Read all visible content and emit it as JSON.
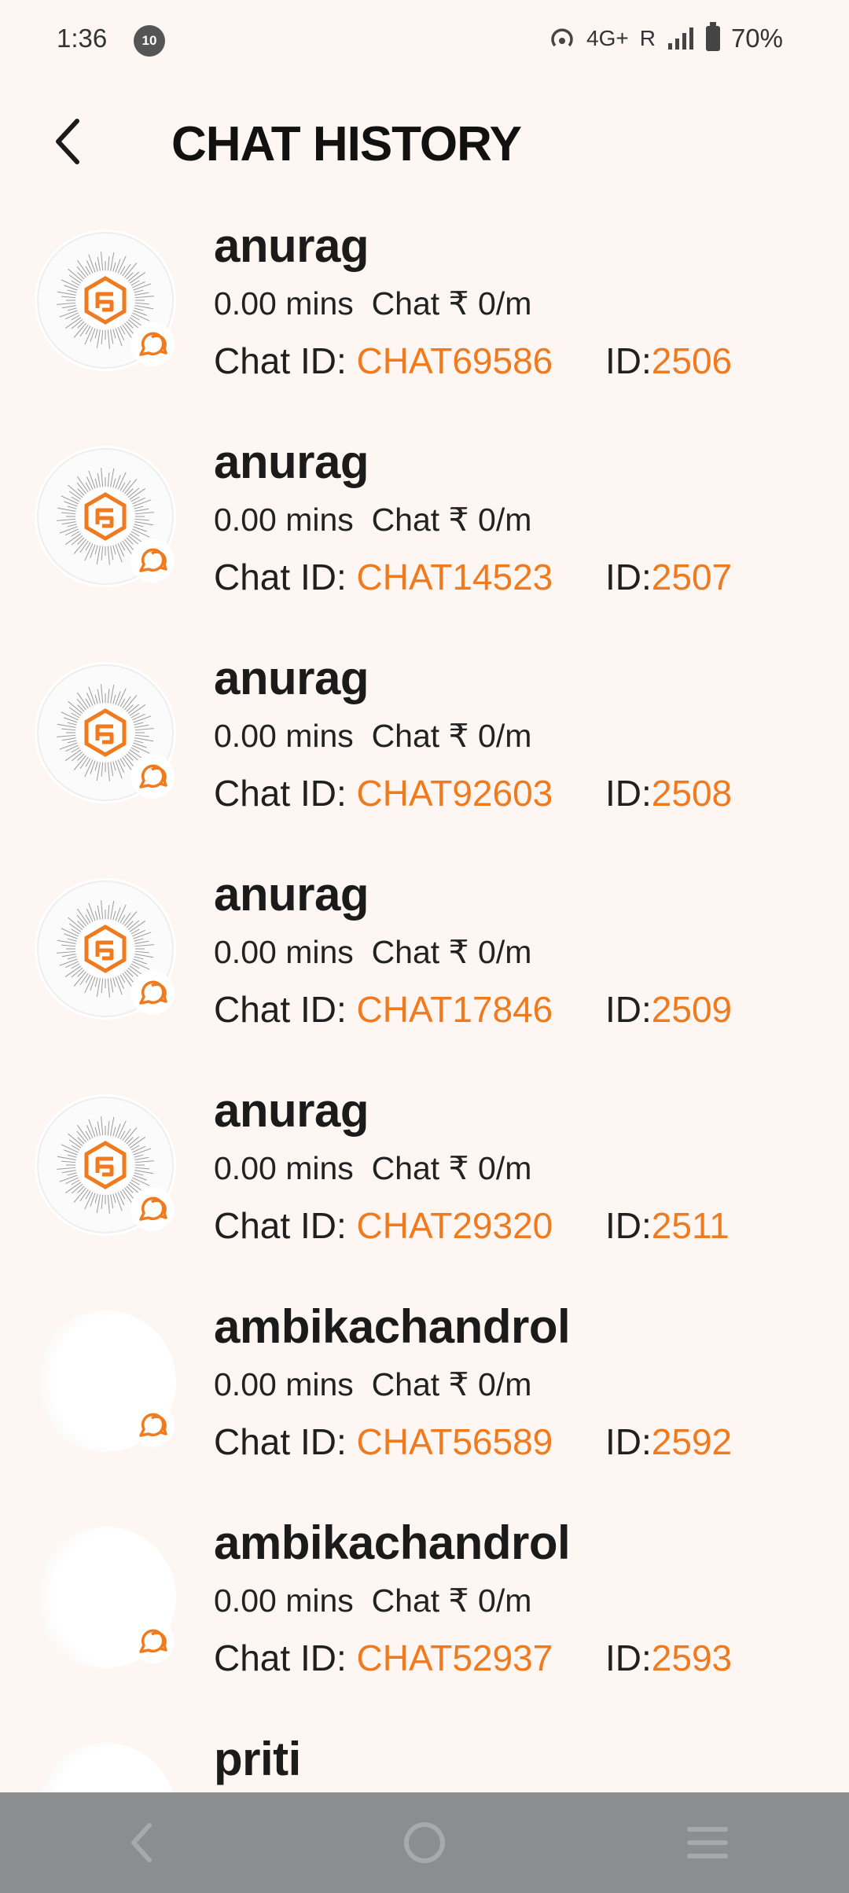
{
  "status_bar": {
    "time": "1:36",
    "notification_count": "10",
    "network": "4G+",
    "roaming": "R",
    "battery": "70%"
  },
  "header": {
    "title": "CHAT HISTORY"
  },
  "chats": [
    {
      "name": "anurag",
      "duration": "0.00 mins",
      "rate": "Chat ₹ 0/m",
      "chat_id_label": "Chat ID: ",
      "chat_id": "CHAT69586",
      "id_label": "ID:",
      "id": "2506",
      "avatar": "logo"
    },
    {
      "name": "anurag",
      "duration": "0.00 mins",
      "rate": "Chat ₹ 0/m",
      "chat_id_label": "Chat ID: ",
      "chat_id": "CHAT14523",
      "id_label": "ID:",
      "id": "2507",
      "avatar": "logo"
    },
    {
      "name": "anurag",
      "duration": "0.00 mins",
      "rate": "Chat ₹ 0/m",
      "chat_id_label": "Chat ID: ",
      "chat_id": "CHAT92603",
      "id_label": "ID:",
      "id": "2508",
      "avatar": "logo"
    },
    {
      "name": "anurag",
      "duration": "0.00 mins",
      "rate": "Chat ₹ 0/m",
      "chat_id_label": "Chat ID: ",
      "chat_id": "CHAT17846",
      "id_label": "ID:",
      "id": "2509",
      "avatar": "logo"
    },
    {
      "name": "anurag",
      "duration": "0.00 mins",
      "rate": "Chat ₹ 0/m",
      "chat_id_label": "Chat ID: ",
      "chat_id": "CHAT29320",
      "id_label": "ID:",
      "id": "2511",
      "avatar": "logo"
    },
    {
      "name": "ambikachandrol",
      "duration": "0.00 mins",
      "rate": "Chat ₹ 0/m",
      "chat_id_label": "Chat ID: ",
      "chat_id": "CHAT56589",
      "id_label": "ID:",
      "id": "2592",
      "avatar": "blank"
    },
    {
      "name": "ambikachandrol",
      "duration": "0.00 mins",
      "rate": "Chat ₹ 0/m",
      "chat_id_label": "Chat ID: ",
      "chat_id": "CHAT52937",
      "id_label": "ID:",
      "id": "2593",
      "avatar": "blank"
    },
    {
      "name": "priti",
      "duration": "",
      "rate": "",
      "chat_id_label": "",
      "chat_id": "",
      "id_label": "",
      "id": "",
      "avatar": "blank"
    }
  ],
  "colors": {
    "accent": "#f07a1e",
    "background": "#fdf6f2",
    "nav_bar": "#8c8d8f"
  },
  "icons": {
    "back": "chevron-left-icon",
    "chat_badge": "chat-bubble-icon",
    "nav_back": "nav-back-icon",
    "nav_home": "nav-home-icon",
    "nav_recents": "nav-recents-icon"
  }
}
